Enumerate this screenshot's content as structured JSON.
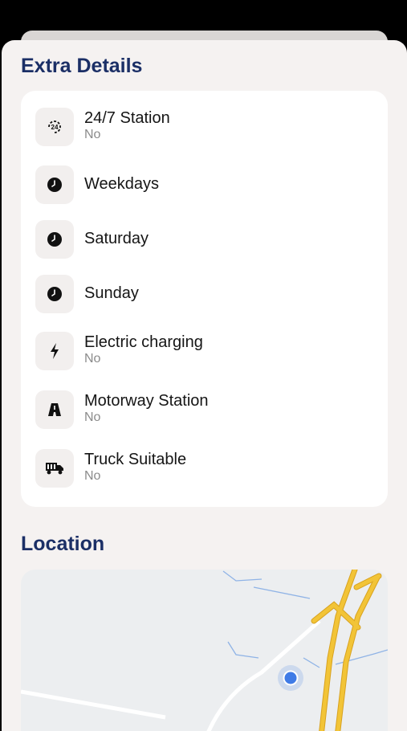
{
  "extra_details": {
    "title": "Extra Details",
    "items": [
      {
        "icon": "24-7-icon",
        "label": "24/7 Station",
        "value": "No"
      },
      {
        "icon": "clock-icon",
        "label": "Weekdays"
      },
      {
        "icon": "clock-icon",
        "label": "Saturday"
      },
      {
        "icon": "clock-icon",
        "label": "Sunday"
      },
      {
        "icon": "lightning-icon",
        "label": "Electric charging",
        "value": "No"
      },
      {
        "icon": "motorway-icon",
        "label": "Motorway Station",
        "value": "No"
      },
      {
        "icon": "truck-icon",
        "label": "Truck Suitable",
        "value": "No"
      }
    ]
  },
  "location": {
    "title": "Location",
    "map": {
      "marker_icon": "location-dot-icon",
      "marker_color": "#3f7be6",
      "highway_color": "#f2c437"
    }
  },
  "colors": {
    "title": "#1b2f66",
    "sheet_bg": "#f5f2f1",
    "card_bg": "#ffffff"
  }
}
